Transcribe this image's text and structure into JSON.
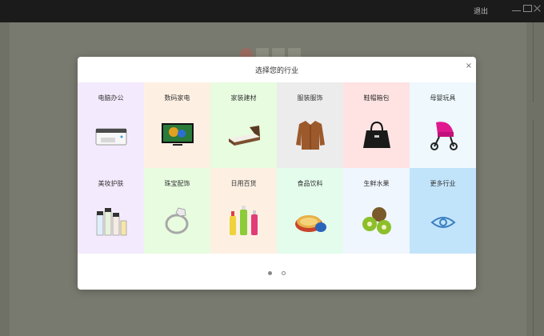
{
  "window": {
    "titlebar_text": "退出",
    "controls": [
      "minimize-icon",
      "maximize-icon",
      "close-icon"
    ]
  },
  "modal": {
    "title": "选择您的行业",
    "close_label": "×",
    "page_count": 2,
    "active_page": 1
  },
  "industries": [
    {
      "label": "电脑办公",
      "icon": "printer-icon",
      "bg": "#f4eafd"
    },
    {
      "label": "数码家电",
      "icon": "tv-icon",
      "bg": "#fdf0e3"
    },
    {
      "label": "家装建材",
      "icon": "bed-icon",
      "bg": "#e8fce0"
    },
    {
      "label": "服装服饰",
      "icon": "coat-icon",
      "bg": "#ececec"
    },
    {
      "label": "鞋帽箱包",
      "icon": "handbag-icon",
      "bg": "#ffe2e2"
    },
    {
      "label": "母婴玩具",
      "icon": "stroller-icon",
      "bg": "#eef8fd"
    },
    {
      "label": "美妆护肤",
      "icon": "cosmetics-icon",
      "bg": "#f4eafd"
    },
    {
      "label": "珠宝配饰",
      "icon": "ring-icon",
      "bg": "#e8fce0"
    },
    {
      "label": "日用百货",
      "icon": "bottles-icon",
      "bg": "#fdf0e3"
    },
    {
      "label": "食品饮料",
      "icon": "snack-tin-icon",
      "bg": "#e3fcec"
    },
    {
      "label": "生鲜水果",
      "icon": "kiwi-icon",
      "bg": "#f0f6fe"
    },
    {
      "label": "更多行业",
      "icon": "eye-icon",
      "bg": "#c2e4fb"
    }
  ]
}
